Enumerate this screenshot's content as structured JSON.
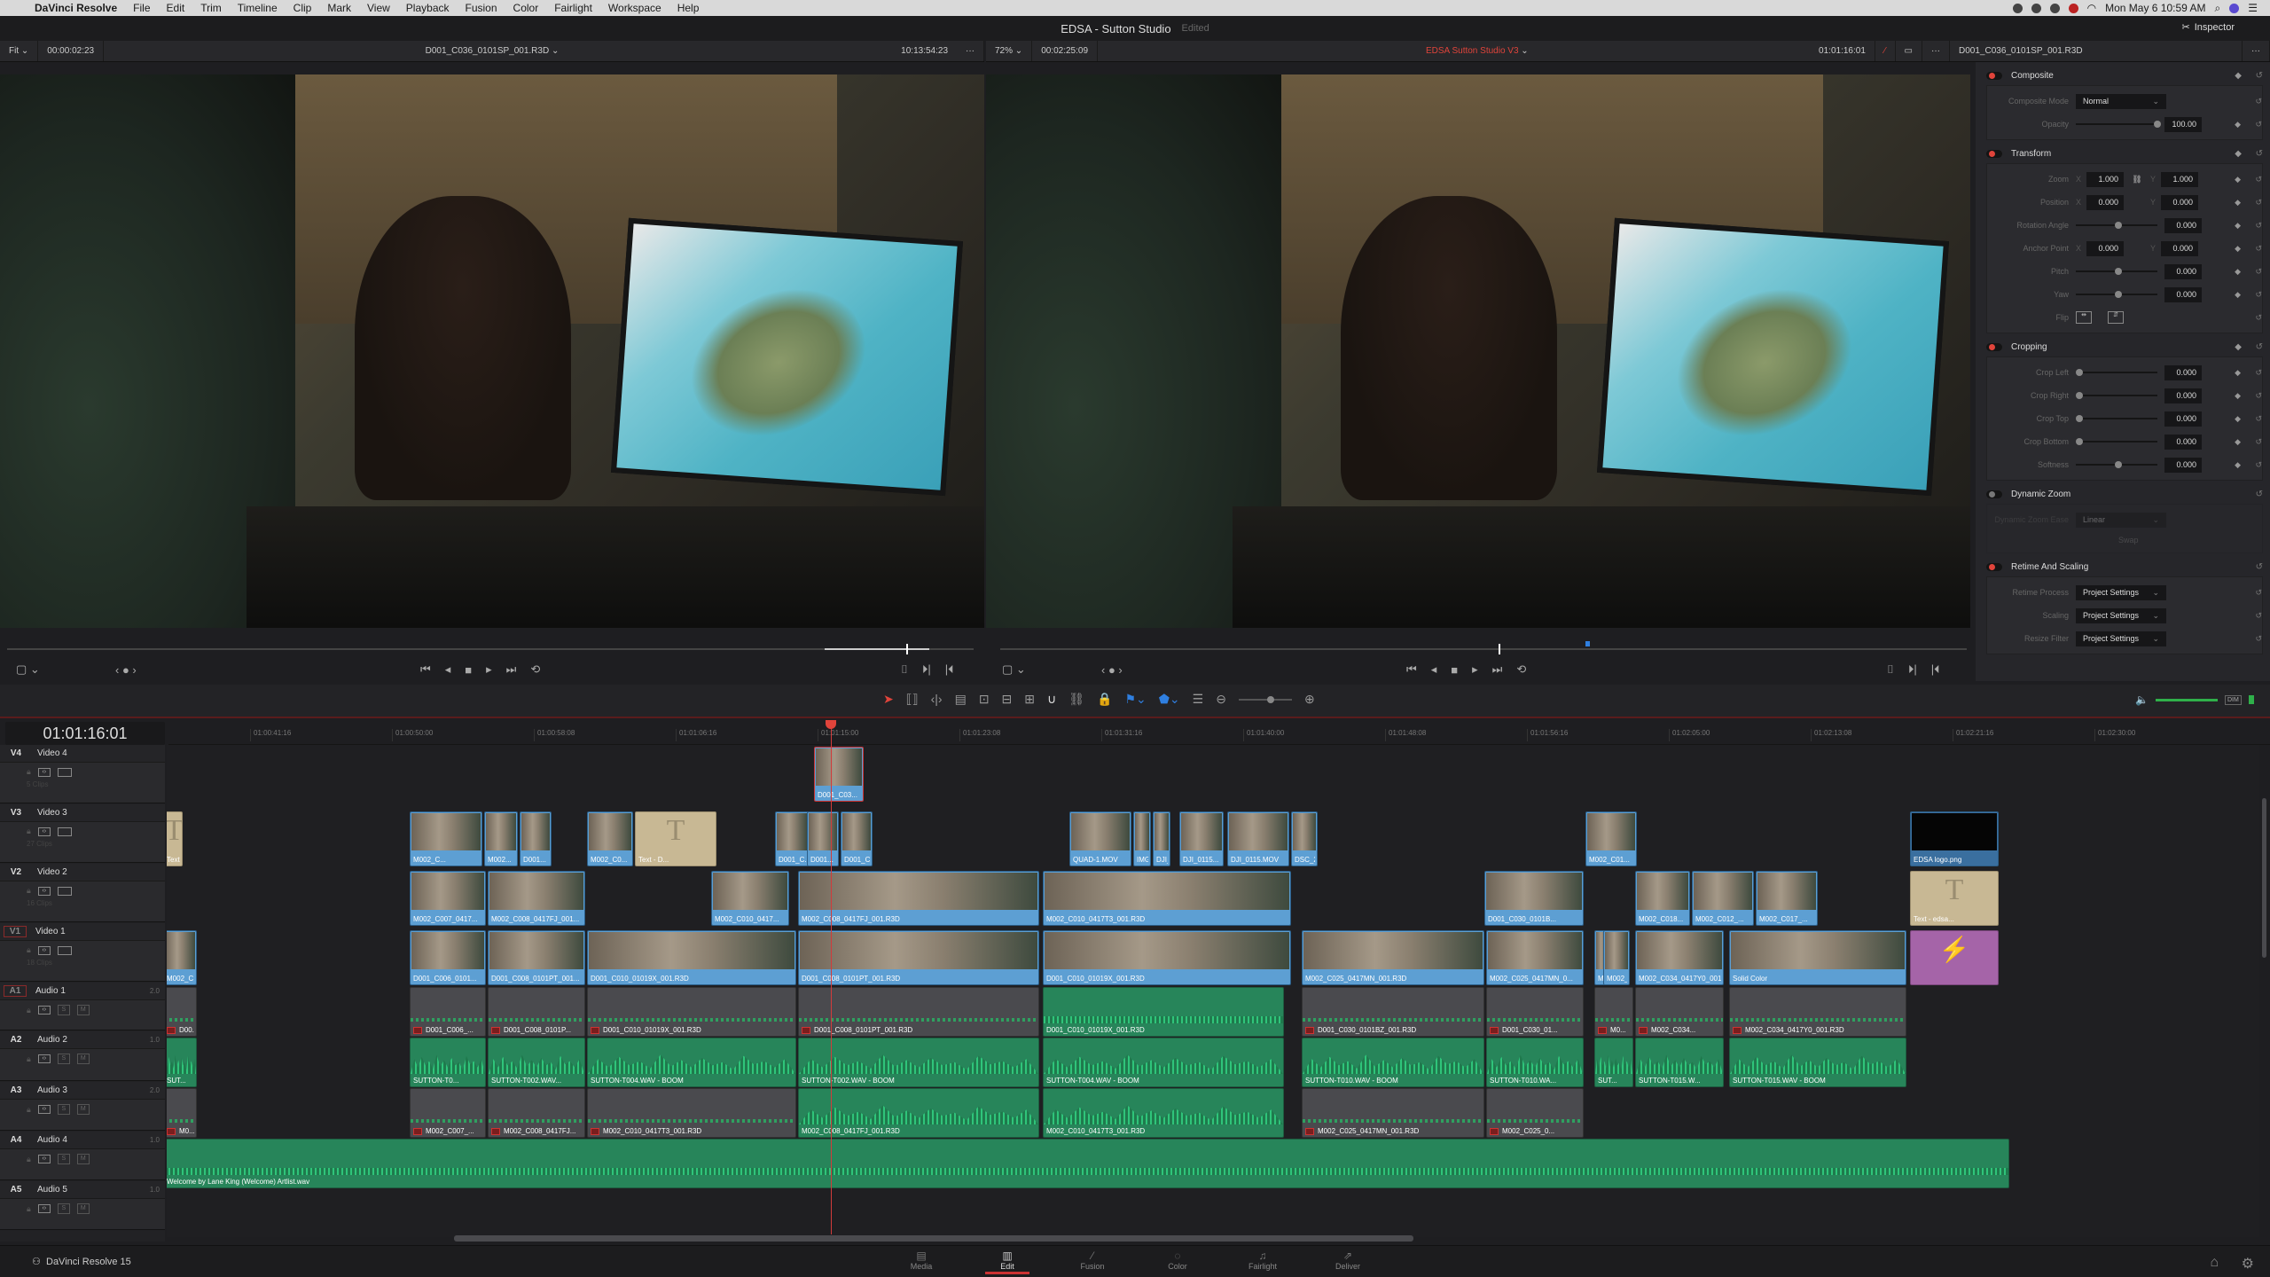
{
  "menubar": {
    "app": "DaVinci Resolve",
    "items": [
      "File",
      "Edit",
      "Trim",
      "Timeline",
      "Clip",
      "Mark",
      "View",
      "Playback",
      "Fusion",
      "Color",
      "Fairlight",
      "Workspace",
      "Help"
    ],
    "clock": "Mon May 6  10:59 AM"
  },
  "titlebar": {
    "project": "EDSA - Sutton Studio",
    "status": "Edited",
    "inspector_label": "Inspector"
  },
  "source_viewer": {
    "zoom": "Fit",
    "duration": "00:00:02:23",
    "clip_name": "D001_C036_0101SP_001.R3D",
    "timecode": "10:13:54:23"
  },
  "timeline_viewer": {
    "zoom": "72%",
    "duration": "00:02:25:09",
    "timeline_name": "EDSA Sutton Studio V3",
    "timecode": "01:01:16:01",
    "clip_name": "D001_C036_0101SP_001.R3D"
  },
  "inspector": {
    "composite": {
      "title": "Composite",
      "mode_label": "Composite Mode",
      "mode": "Normal",
      "opacity_label": "Opacity",
      "opacity": "100.00"
    },
    "transform": {
      "title": "Transform",
      "zoom_label": "Zoom",
      "zoom_x": "1.000",
      "zoom_y": "1.000",
      "position_label": "Position",
      "position_x": "0.000",
      "position_y": "0.000",
      "rotation_label": "Rotation Angle",
      "rotation": "0.000",
      "anchor_label": "Anchor Point",
      "anchor_x": "0.000",
      "anchor_y": "0.000",
      "pitch_label": "Pitch",
      "pitch": "0.000",
      "yaw_label": "Yaw",
      "yaw": "0.000",
      "flip_label": "Flip"
    },
    "cropping": {
      "title": "Cropping",
      "left_label": "Crop Left",
      "left": "0.000",
      "right_label": "Crop Right",
      "right": "0.000",
      "top_label": "Crop Top",
      "top": "0.000",
      "bottom_label": "Crop Bottom",
      "bottom": "0.000",
      "softness_label": "Softness",
      "softness": "0.000"
    },
    "dynamic_zoom": {
      "title": "Dynamic Zoom",
      "ease_label": "Dynamic Zoom Ease",
      "ease": "Linear",
      "swap": "Swap"
    },
    "retime": {
      "title": "Retime And Scaling",
      "process_label": "Retime Process",
      "process": "Project Settings",
      "scaling_label": "Scaling",
      "scaling": "Project Settings",
      "filter_label": "Resize Filter",
      "filter": "Project Settings"
    }
  },
  "timeline": {
    "timecode": "01:01:16:01",
    "ruler": [
      "01:00:41:16",
      "01:00:50:00",
      "01:00:58:08",
      "01:01:06:16",
      "01:01:15:00",
      "01:01:23:08",
      "01:01:31:16",
      "01:01:40:00",
      "01:01:48:08",
      "01:01:56:16",
      "01:02:05:00",
      "01:02:13:08",
      "01:02:21:16",
      "01:02:30:00"
    ],
    "tracks": [
      {
        "id": "V4",
        "name": "Video 4",
        "count": "5 Clips"
      },
      {
        "id": "V3",
        "name": "Video 3",
        "count": "27 Clips"
      },
      {
        "id": "V2",
        "name": "Video 2",
        "count": "16 Clips"
      },
      {
        "id": "V1",
        "name": "Video 1",
        "count": "18 Clips"
      },
      {
        "id": "A1",
        "name": "Audio 1",
        "vol": "2.0"
      },
      {
        "id": "A2",
        "name": "Audio 2",
        "vol": "1.0"
      },
      {
        "id": "A3",
        "name": "Audio 3",
        "vol": "2.0"
      },
      {
        "id": "A4",
        "name": "Audio 4",
        "vol": "1.0"
      },
      {
        "id": "A5",
        "name": "Audio 5",
        "vol": "1.0"
      }
    ],
    "clips": {
      "v4": [
        "D001_C03..."
      ],
      "v3": [
        "Text...",
        "M002_C...",
        "M002...",
        "D001...",
        "M002_C0...",
        "Text - D...",
        "D001_C...",
        "D001...",
        "D001_C003...",
        "QUAD-1.MOV",
        "IMG_...",
        "DJI_0...",
        "DJI_0115...",
        "DJI_0115.MOV",
        "DSC_2799...",
        "M002_C01...",
        "EDSA logo.png"
      ],
      "v2": [
        "M002_C007_0417...",
        "M002_C008_0417FJ_001...",
        "M002_C010_0417...",
        "M002_C008_0417FJ_001.R3D",
        "M002_C010_0417T3_001.R3D",
        "D001_C030_0101B...",
        "M002_C018...",
        "M002_C012_...",
        "M002_C017_...",
        "Text - edsa..."
      ],
      "v1": [
        "M002_C...",
        "D001_C006_0101...",
        "D001_C008_0101PT_001...",
        "D001_C010_01019X_001.R3D",
        "D001_C008_0101PT_001.R3D",
        "D001_C010_01019X_001.R3D",
        "M002_C025_0417MN_001.R3D",
        "M002_C025_0417MN_0...",
        "M0...",
        "M002_C034_0417Y0_...",
        "M002_C034_0417Y0_001.R3D",
        "Solid Color"
      ],
      "a1": [
        "D00...",
        "D001_C006_...",
        "D001_C008_0101P...",
        "D001_C010_01019X_001.R3D",
        "D001_C008_0101PT_001.R3D",
        "D001_C010_01019X_001.R3D",
        "D001_C030_0101BZ_001.R3D",
        "D001_C030_01...",
        "M0...",
        "M002_C034...",
        "M002_C034_0417Y0_001.R3D"
      ],
      "a2": [
        "SUT...",
        "SUTTON-T0...",
        "SUTTON-T002.WAV...",
        "SUTTON-T004.WAV - BOOM",
        "SUTTON-T002.WAV - BOOM",
        "SUTTON-T004.WAV - BOOM",
        "SUTTON-T010.WAV - BOOM",
        "SUTTON-T010.WA...",
        "SUT...",
        "SUTTON-T015.W...",
        "SUTTON-T015.WAV - BOOM"
      ],
      "a3": [
        "M0...",
        "M002_C007_...",
        "M002_C008_0417FJ...",
        "M002_C010_0417T3_001.R3D",
        "M002_C008_0417FJ_001.R3D",
        "M002_C010_0417T3_001.R3D",
        "M002_C025_0417MN_001.R3D",
        "M002_C025_0..."
      ],
      "a4": [
        "Welcome by Lane King (Welcome) Artlist.wav"
      ]
    }
  },
  "pages": [
    "Media",
    "Edit",
    "Fusion",
    "Color",
    "Fairlight",
    "Deliver"
  ],
  "active_page": "Edit",
  "brand": "DaVinci Resolve 15",
  "colors": {
    "accent_red": "#e0443b",
    "clip_blue": "#5d9fd3",
    "audio_green": "#27855a",
    "text_clip": "#c8b894",
    "solid_clip": "#a564a8"
  }
}
